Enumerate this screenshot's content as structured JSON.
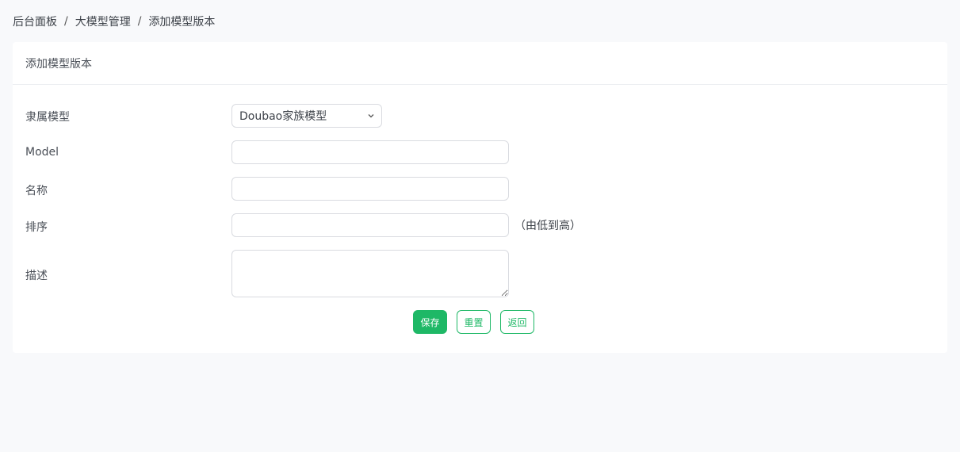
{
  "breadcrumb": {
    "items": [
      "后台面板",
      "大模型管理",
      "添加模型版本"
    ],
    "separator": "/"
  },
  "card": {
    "title": "添加模型版本"
  },
  "form": {
    "model_family": {
      "label": "隶属模型",
      "value": "Doubao家族模型"
    },
    "model": {
      "label": "Model",
      "value": "",
      "placeholder": ""
    },
    "name": {
      "label": "名称",
      "value": "",
      "placeholder": ""
    },
    "sort": {
      "label": "排序",
      "value": "",
      "hint": "（由低到高）"
    },
    "description": {
      "label": "描述",
      "value": ""
    }
  },
  "actions": {
    "save_label": "保存",
    "reset_label": "重置",
    "back_label": "返回"
  },
  "colors": {
    "accent": "#1eb866",
    "page_bg": "#f8f9fb",
    "card_bg": "#ffffff"
  }
}
